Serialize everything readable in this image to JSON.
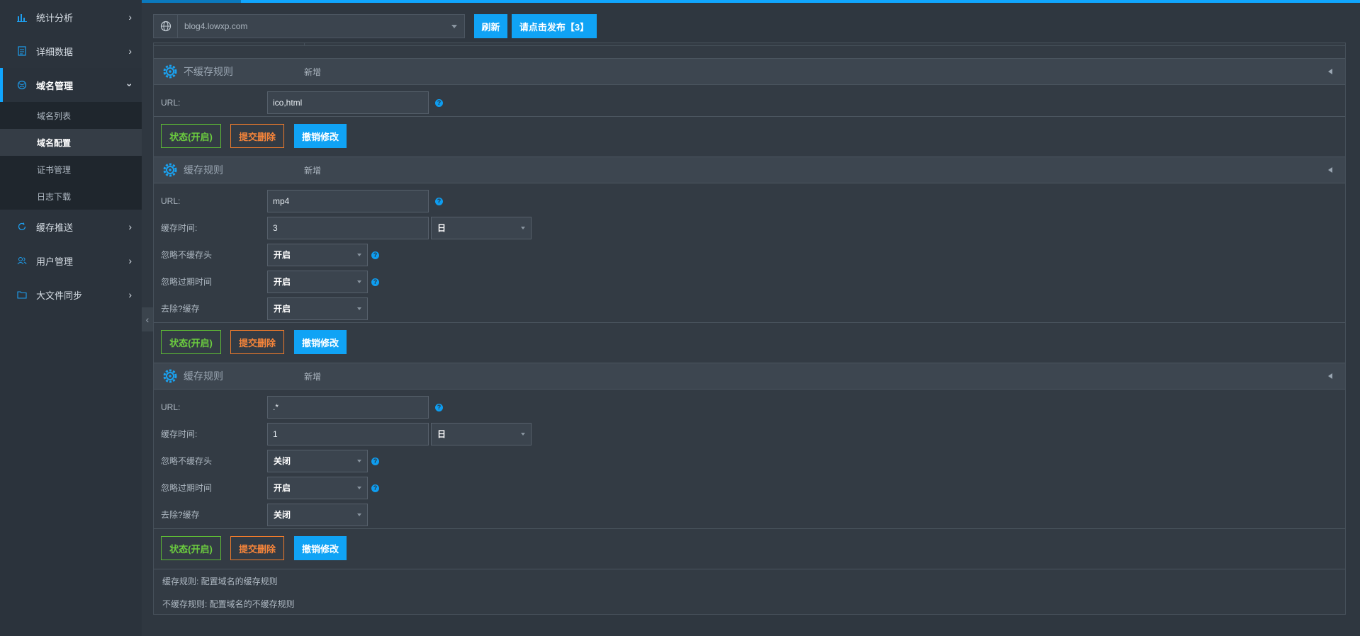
{
  "sidebar": {
    "items": [
      {
        "label": "统计分析"
      },
      {
        "label": "详细数据"
      },
      {
        "label": "域名管理"
      },
      {
        "label": "缓存推送"
      },
      {
        "label": "用户管理"
      },
      {
        "label": "大文件同步"
      }
    ],
    "submenu": [
      {
        "label": "域名列表"
      },
      {
        "label": "域名配置"
      },
      {
        "label": "证书管理"
      },
      {
        "label": "日志下载"
      }
    ]
  },
  "topbar": {
    "domain": "blog4.lowxp.com",
    "refresh_label": "刷新",
    "publish_label": "请点击发布【3】"
  },
  "sections": [
    {
      "title": "不缓存规则",
      "add_label": "新增",
      "url_label": "URL:",
      "url_value": "ico,html"
    },
    {
      "title": "缓存规则",
      "add_label": "新增",
      "url_label": "URL:",
      "url_value": "mp4",
      "time_label": "缓存时间:",
      "time_value": "3",
      "time_unit": "日",
      "ignore_nocache_label": "忽略不缓存头",
      "ignore_nocache_value": "开启",
      "ignore_expire_label": "忽略过期时间",
      "ignore_expire_value": "开启",
      "strip_query_label": "去除?缓存",
      "strip_query_value": "开启"
    },
    {
      "title": "缓存规则",
      "add_label": "新增",
      "url_label": "URL:",
      "url_value": ".*",
      "time_label": "缓存时间:",
      "time_value": "1",
      "time_unit": "日",
      "ignore_nocache_label": "忽略不缓存头",
      "ignore_nocache_value": "关闭",
      "ignore_expire_label": "忽略过期时间",
      "ignore_expire_value": "开启",
      "strip_query_label": "去除?缓存",
      "strip_query_value": "关闭"
    }
  ],
  "buttons": {
    "status": "状态(开启)",
    "delete": "提交删除",
    "cancel": "撤销修改"
  },
  "notes": [
    "缓存规则: 配置域名的缓存规则",
    "不缓存规则: 配置域名的不缓存规则"
  ],
  "colors": {
    "accent": "#10a6ff",
    "green": "#6ccd3f",
    "orange": "#f7853a"
  },
  "icons": {
    "help": "?",
    "globe": "globe-icon",
    "gear": "gear-icon"
  }
}
